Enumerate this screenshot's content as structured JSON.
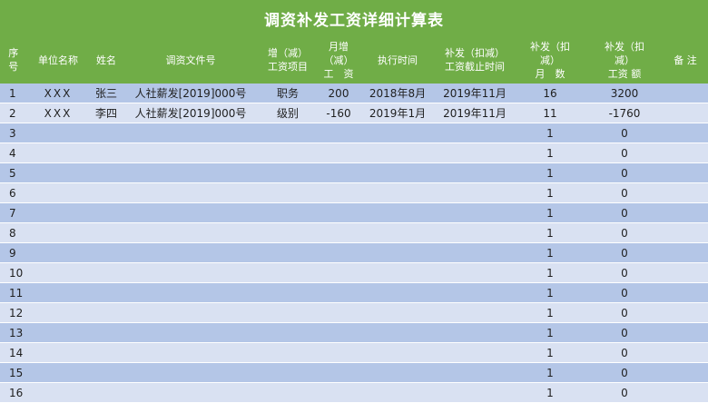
{
  "title": "调资补发工资详细计算表",
  "columns": [
    "序\n号",
    "单位名称",
    "姓名",
    "调资文件号",
    "增（减）\n工资项目",
    "月增\n（减）\n工　资",
    "执行时间",
    "补发（扣减）\n工资截止时间",
    "补发（扣\n减）\n月　数",
    "补发（扣\n减）\n工资 额",
    "备 注"
  ],
  "rows": [
    {
      "seq": "1",
      "unit": "XXX",
      "name": "张三",
      "doc": "人社薪发[2019]000号",
      "item": "职务",
      "monthly": "200",
      "start": "2018年8月",
      "end": "2019年11月",
      "months": "16",
      "amount": "3200",
      "note": ""
    },
    {
      "seq": "2",
      "unit": "XXX",
      "name": "李四",
      "doc": "人社薪发[2019]000号",
      "item": "级别",
      "monthly": "-160",
      "start": "2019年1月",
      "end": "2019年11月",
      "months": "11",
      "amount": "-1760",
      "note": ""
    },
    {
      "seq": "3",
      "unit": "",
      "name": "",
      "doc": "",
      "item": "",
      "monthly": "",
      "start": "",
      "end": "",
      "months": "1",
      "amount": "0",
      "note": ""
    },
    {
      "seq": "4",
      "unit": "",
      "name": "",
      "doc": "",
      "item": "",
      "monthly": "",
      "start": "",
      "end": "",
      "months": "1",
      "amount": "0",
      "note": ""
    },
    {
      "seq": "5",
      "unit": "",
      "name": "",
      "doc": "",
      "item": "",
      "monthly": "",
      "start": "",
      "end": "",
      "months": "1",
      "amount": "0",
      "note": ""
    },
    {
      "seq": "6",
      "unit": "",
      "name": "",
      "doc": "",
      "item": "",
      "monthly": "",
      "start": "",
      "end": "",
      "months": "1",
      "amount": "0",
      "note": ""
    },
    {
      "seq": "7",
      "unit": "",
      "name": "",
      "doc": "",
      "item": "",
      "monthly": "",
      "start": "",
      "end": "",
      "months": "1",
      "amount": "0",
      "note": ""
    },
    {
      "seq": "8",
      "unit": "",
      "name": "",
      "doc": "",
      "item": "",
      "monthly": "",
      "start": "",
      "end": "",
      "months": "1",
      "amount": "0",
      "note": ""
    },
    {
      "seq": "9",
      "unit": "",
      "name": "",
      "doc": "",
      "item": "",
      "monthly": "",
      "start": "",
      "end": "",
      "months": "1",
      "amount": "0",
      "note": ""
    },
    {
      "seq": "10",
      "unit": "",
      "name": "",
      "doc": "",
      "item": "",
      "monthly": "",
      "start": "",
      "end": "",
      "months": "1",
      "amount": "0",
      "note": ""
    },
    {
      "seq": "11",
      "unit": "",
      "name": "",
      "doc": "",
      "item": "",
      "monthly": "",
      "start": "",
      "end": "",
      "months": "1",
      "amount": "0",
      "note": ""
    },
    {
      "seq": "12",
      "unit": "",
      "name": "",
      "doc": "",
      "item": "",
      "monthly": "",
      "start": "",
      "end": "",
      "months": "1",
      "amount": "0",
      "note": ""
    },
    {
      "seq": "13",
      "unit": "",
      "name": "",
      "doc": "",
      "item": "",
      "monthly": "",
      "start": "",
      "end": "",
      "months": "1",
      "amount": "0",
      "note": ""
    },
    {
      "seq": "14",
      "unit": "",
      "name": "",
      "doc": "",
      "item": "",
      "monthly": "",
      "start": "",
      "end": "",
      "months": "1",
      "amount": "0",
      "note": ""
    },
    {
      "seq": "15",
      "unit": "",
      "name": "",
      "doc": "",
      "item": "",
      "monthly": "",
      "start": "",
      "end": "",
      "months": "1",
      "amount": "0",
      "note": ""
    },
    {
      "seq": "16",
      "unit": "",
      "name": "",
      "doc": "",
      "item": "",
      "monthly": "",
      "start": "",
      "end": "",
      "months": "1",
      "amount": "0",
      "note": ""
    }
  ],
  "colors": {
    "header_green": "#70ad47",
    "row_band_dark": "#b4c6e7",
    "row_band_light": "#d9e1f2"
  }
}
